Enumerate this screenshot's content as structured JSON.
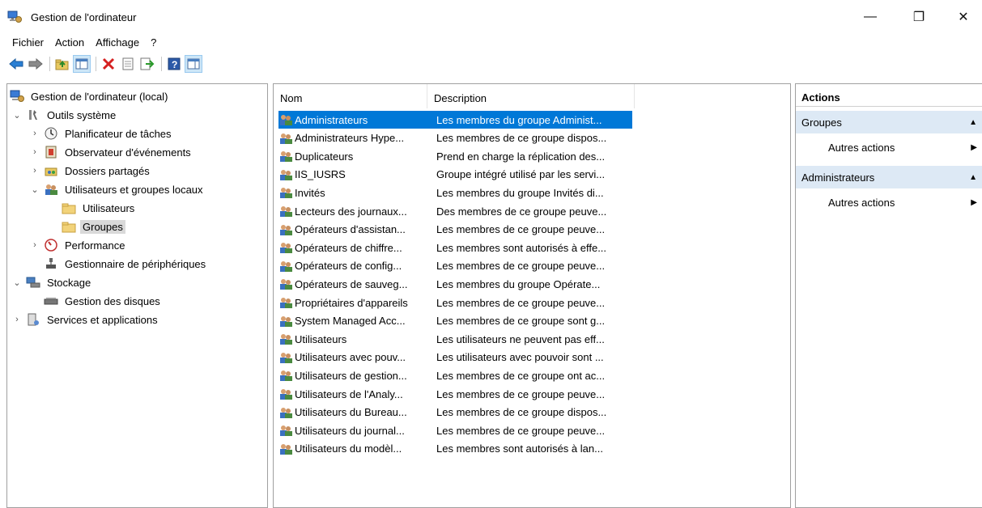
{
  "window": {
    "title": "Gestion de l'ordinateur",
    "controls": {
      "minimize": "—",
      "maximize": "❐",
      "close": "✕"
    }
  },
  "menu": [
    "Fichier",
    "Action",
    "Affichage",
    "?"
  ],
  "toolbar": {
    "icons": [
      "back-arrow-icon",
      "forward-arrow-icon",
      "up-folder-icon",
      "show-tree-icon",
      "delete-icon",
      "properties-icon",
      "export-icon",
      "help-icon",
      "action-pane-icon"
    ]
  },
  "tree": {
    "items": [
      {
        "label": "Gestion de l'ordinateur (local)",
        "twisty": "",
        "icon": "computer-management-icon"
      },
      {
        "label": "Outils système",
        "twisty": "⌄",
        "icon": "tools-icon"
      },
      {
        "label": "Planificateur de tâches",
        "twisty": "›",
        "icon": "clock-icon"
      },
      {
        "label": "Observateur d'événements",
        "twisty": "›",
        "icon": "event-viewer-icon"
      },
      {
        "label": "Dossiers partagés",
        "twisty": "›",
        "icon": "shared-folder-icon"
      },
      {
        "label": "Utilisateurs et groupes locaux",
        "twisty": "⌄",
        "icon": "users-groups-icon"
      },
      {
        "label": "Utilisateurs",
        "twisty": "",
        "icon": "folder-icon"
      },
      {
        "label": "Groupes",
        "twisty": "",
        "icon": "folder-icon"
      },
      {
        "label": "Performance",
        "twisty": "›",
        "icon": "performance-icon"
      },
      {
        "label": "Gestionnaire de périphériques",
        "twisty": "",
        "icon": "device-manager-icon"
      },
      {
        "label": "Stockage",
        "twisty": "⌄",
        "icon": "storage-icon"
      },
      {
        "label": "Gestion des disques",
        "twisty": "",
        "icon": "disk-icon"
      },
      {
        "label": "Services et applications",
        "twisty": "›",
        "icon": "services-icon"
      }
    ],
    "selected": "Groupes"
  },
  "list": {
    "columns": {
      "name": "Nom",
      "description": "Description"
    },
    "rows": [
      {
        "name": "Administrateurs",
        "description": "Les membres du groupe Administ..."
      },
      {
        "name": "Administrateurs Hype...",
        "description": "Les membres de ce groupe dispos..."
      },
      {
        "name": "Duplicateurs",
        "description": "Prend en charge la réplication des..."
      },
      {
        "name": "IIS_IUSRS",
        "description": "Groupe intégré utilisé par les servi..."
      },
      {
        "name": "Invités",
        "description": "Les membres du groupe Invités di..."
      },
      {
        "name": "Lecteurs des journaux...",
        "description": "Des membres de ce groupe peuve..."
      },
      {
        "name": "Opérateurs d'assistan...",
        "description": "Les membres de ce groupe peuve..."
      },
      {
        "name": "Opérateurs de chiffre...",
        "description": "Les membres sont autorisés à effe..."
      },
      {
        "name": "Opérateurs de config...",
        "description": "Les membres de ce groupe peuve..."
      },
      {
        "name": "Opérateurs de sauveg...",
        "description": "Les membres du groupe Opérate..."
      },
      {
        "name": "Propriétaires d'appareils",
        "description": "Les membres de ce groupe peuve..."
      },
      {
        "name": "System Managed Acc...",
        "description": "Les membres de ce groupe sont g..."
      },
      {
        "name": "Utilisateurs",
        "description": "Les utilisateurs ne peuvent pas eff..."
      },
      {
        "name": "Utilisateurs avec pouv...",
        "description": "Les utilisateurs avec pouvoir sont ..."
      },
      {
        "name": "Utilisateurs de gestion...",
        "description": "Les membres de ce groupe ont ac..."
      },
      {
        "name": "Utilisateurs de l'Analy...",
        "description": "Les membres de ce groupe peuve..."
      },
      {
        "name": "Utilisateurs du Bureau...",
        "description": "Les membres de ce groupe dispos..."
      },
      {
        "name": "Utilisateurs du journal...",
        "description": "Les membres de ce groupe peuve..."
      },
      {
        "name": "Utilisateurs du modèl...",
        "description": "Les membres sont autorisés à lan..."
      }
    ],
    "selected": "Administrateurs"
  },
  "actions": {
    "header": "Actions",
    "sections": [
      {
        "title": "Groupes",
        "item": "Autres actions"
      },
      {
        "title": "Administrateurs",
        "item": "Autres actions"
      }
    ]
  },
  "colors": {
    "selection": "#0078d7",
    "section_bg": "#dde9f5",
    "tree_selected": "#d9d9d9"
  }
}
